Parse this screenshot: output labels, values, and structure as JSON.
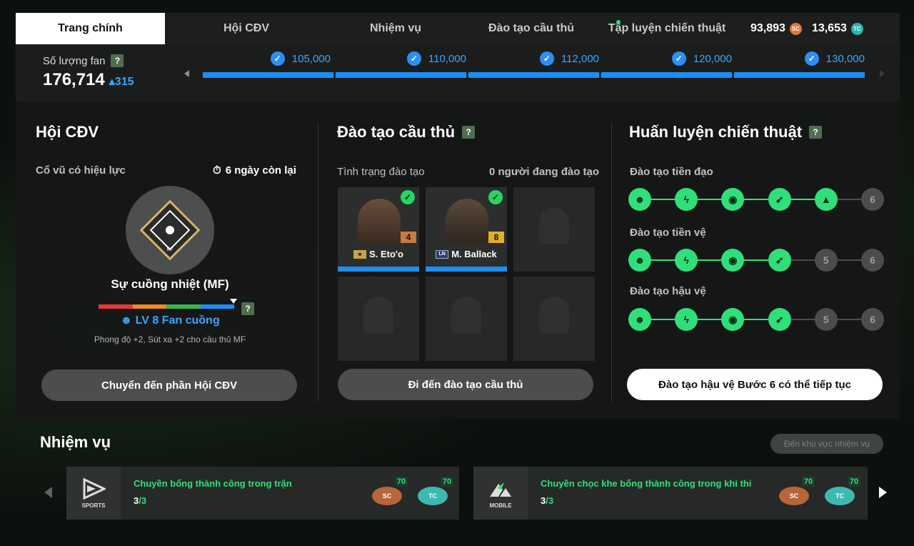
{
  "nav": {
    "tabs": [
      {
        "label": "Trang chính"
      },
      {
        "label": "Hội CĐV"
      },
      {
        "label": "Nhiệm vụ"
      },
      {
        "label": "Đào tạo cầu thủ"
      },
      {
        "label": "Tập luyện chiến thuật"
      }
    ],
    "sc_amount": "93,893",
    "tc_amount": "13,653",
    "sc_coin_text": "SC",
    "tc_coin_text": "TC"
  },
  "fans": {
    "label": "Số lượng fan",
    "help": "?",
    "count": "176,714",
    "delta": "▴315",
    "milestones": [
      "105,000",
      "110,000",
      "112,000",
      "120,000",
      "130,000"
    ]
  },
  "club": {
    "title": "Hội CĐV",
    "effect_label": "Cổ vũ có hiệu lực",
    "days_left": "6 ngày còn lại",
    "badge_text": "MF",
    "skill_name": "Sự cuồng nhiệt (MF)",
    "help": "?",
    "level_text": "☻ LV 8 Fan cuồng",
    "level_desc": "Phong độ +2, Sút xa +2 cho cầu thủ MF",
    "button": "Chuyển đến phần Hội CĐV",
    "level_colors": [
      "#e23a3a",
      "#f08a24",
      "#3db54a",
      "#1b8ef7"
    ]
  },
  "training": {
    "title": "Đào tạo cầu thủ",
    "help": "?",
    "status_label": "Tình trạng đào tạo",
    "count_label": "0 người đang đào tạo",
    "players": [
      {
        "name": "S. Eto'o",
        "ovr": "4",
        "card": "★",
        "ovr_color": "#c87a3f"
      },
      {
        "name": "M. Ballack",
        "ovr": "8",
        "card": "LN",
        "ovr_color": "#e0b028"
      }
    ],
    "button": "Đi đến đào tạo cầu thủ"
  },
  "tactics": {
    "title": "Huấn luyện chiến thuật",
    "help": "?",
    "tracks": [
      {
        "label": "Đào tạo tiền đạo",
        "nodes": [
          "",
          "",
          "",
          "",
          "",
          "6"
        ],
        "done": 5
      },
      {
        "label": "Đào tạo tiền vệ",
        "nodes": [
          "",
          "",
          "",
          "",
          "5",
          "6"
        ],
        "done": 4
      },
      {
        "label": "Đào tạo hậu vệ",
        "nodes": [
          "",
          "",
          "",
          "",
          "5",
          "6"
        ],
        "done": 4
      }
    ],
    "button": "Đào tạo hậu vệ Bước 6 có thể tiếp tục"
  },
  "missions": {
    "title": "Nhiệm vụ",
    "link": "Đến khu vực nhiệm vụ",
    "items": [
      {
        "logo": "SPORTS",
        "text": "Chuyền bổng thành công trong trận",
        "progress_done": "3",
        "progress_total": "/3",
        "sc": "70",
        "tc": "70"
      },
      {
        "logo": "MOBILE",
        "text": "Chuyền chọc khe bổng thành công trong khi thi",
        "progress_done": "3",
        "progress_total": "/3",
        "sc": "70",
        "tc": "70"
      }
    ]
  }
}
